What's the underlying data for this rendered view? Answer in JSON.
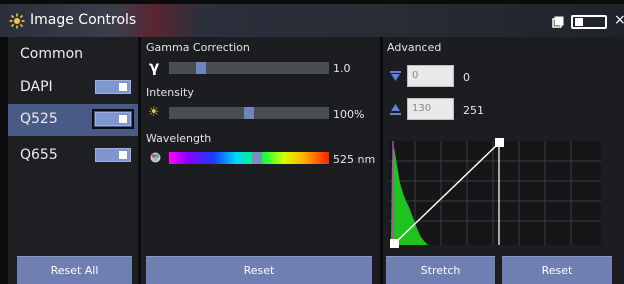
{
  "window": {
    "title": "Image Controls",
    "close_glyph": "×",
    "icons": {
      "app": "sun-icon",
      "restore": "restore-icon",
      "toggle": "toggle-icon"
    }
  },
  "channels": {
    "header": "Common",
    "items": [
      {
        "label": "DAPI",
        "enabled": true,
        "selected": false
      },
      {
        "label": "Q525",
        "enabled": true,
        "selected": true
      },
      {
        "label": "Q655",
        "enabled": true,
        "selected": false
      }
    ],
    "reset_all_label": "Reset All"
  },
  "controls": {
    "gamma": {
      "label": "Gamma Correction",
      "symbol": "γ",
      "value": "1.0",
      "position": 0.18
    },
    "intensity": {
      "label": "Intensity",
      "symbol": "☀",
      "value": "100%",
      "position": 0.5
    },
    "wavelength": {
      "label": "Wavelength",
      "value": "525 nm",
      "position": 0.55
    },
    "reset_label": "Reset"
  },
  "advanced": {
    "label": "Advanced",
    "min_input": {
      "value": "0",
      "display": "0"
    },
    "max_input": {
      "value": "130",
      "display": "251"
    },
    "stretch_label": "Stretch",
    "reset_label": "Reset"
  },
  "colors": {
    "accent": "#6f7fb2",
    "selected": "#4a5a86",
    "histogram": "#1fc21f"
  }
}
